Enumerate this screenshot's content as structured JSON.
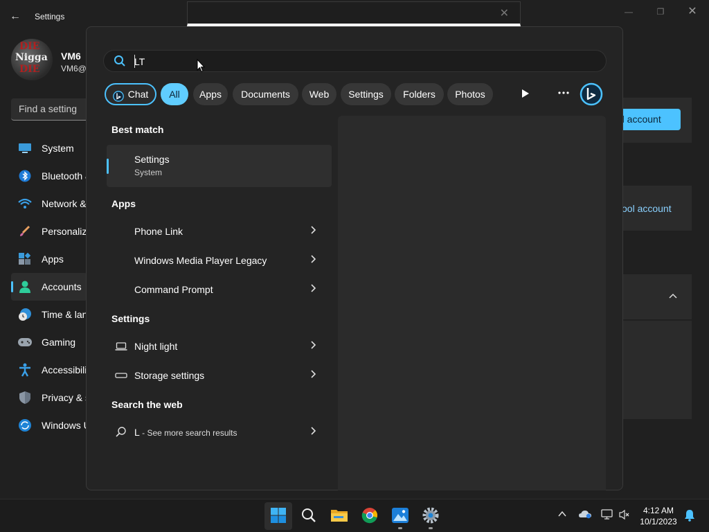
{
  "settings_window": {
    "title": "Settings",
    "profile": {
      "name": "VM6",
      "email": "VM6@",
      "avatar_text": [
        "DIE",
        "Nigga",
        "DIE"
      ]
    },
    "find_placeholder": "Find a setting",
    "nav": [
      {
        "label": "System",
        "icon": "monitor-icon"
      },
      {
        "label": "Bluetooth & devices",
        "icon": "bluetooth-icon"
      },
      {
        "label": "Network & internet",
        "icon": "wifi-icon"
      },
      {
        "label": "Personalization",
        "icon": "brush-icon"
      },
      {
        "label": "Apps",
        "icon": "apps-icon"
      },
      {
        "label": "Accounts",
        "icon": "person-icon",
        "active": true
      },
      {
        "label": "Time & language",
        "icon": "clock-globe-icon"
      },
      {
        "label": "Gaming",
        "icon": "gamepad-icon"
      },
      {
        "label": "Accessibility",
        "icon": "accessibility-icon"
      },
      {
        "label": "Privacy & security",
        "icon": "shield-icon"
      },
      {
        "label": "Windows Update",
        "icon": "update-icon"
      }
    ],
    "add_account_label": "d account",
    "school_account_label": "ool account"
  },
  "search": {
    "query": "LT",
    "filters": [
      "Chat",
      "All",
      "Apps",
      "Documents",
      "Web",
      "Settings",
      "Folders",
      "Photos"
    ],
    "active_filter": "All",
    "sections": {
      "best_match": "Best match",
      "apps": "Apps",
      "settings": "Settings",
      "web": "Search the web"
    },
    "best_match": {
      "title": "Settings",
      "subtitle": "System"
    },
    "apps": [
      "Phone Link",
      "Windows Media Player Legacy",
      "Command Prompt"
    ],
    "settings": [
      "Night light",
      "Storage settings"
    ],
    "web": {
      "query": "L",
      "suffix": " - See more search results"
    }
  },
  "taskbar": {
    "clock_time": "4:12 AM",
    "clock_date": "10/1/2023",
    "apps": [
      "start-icon",
      "search-icon",
      "file-explorer-icon",
      "chrome-icon",
      "photos-icon",
      "settings-gear-icon"
    ]
  },
  "colors": {
    "accent": "#4cc2ff",
    "chip_active": "#60cdff",
    "panel": "#242424",
    "background": "#202020"
  }
}
